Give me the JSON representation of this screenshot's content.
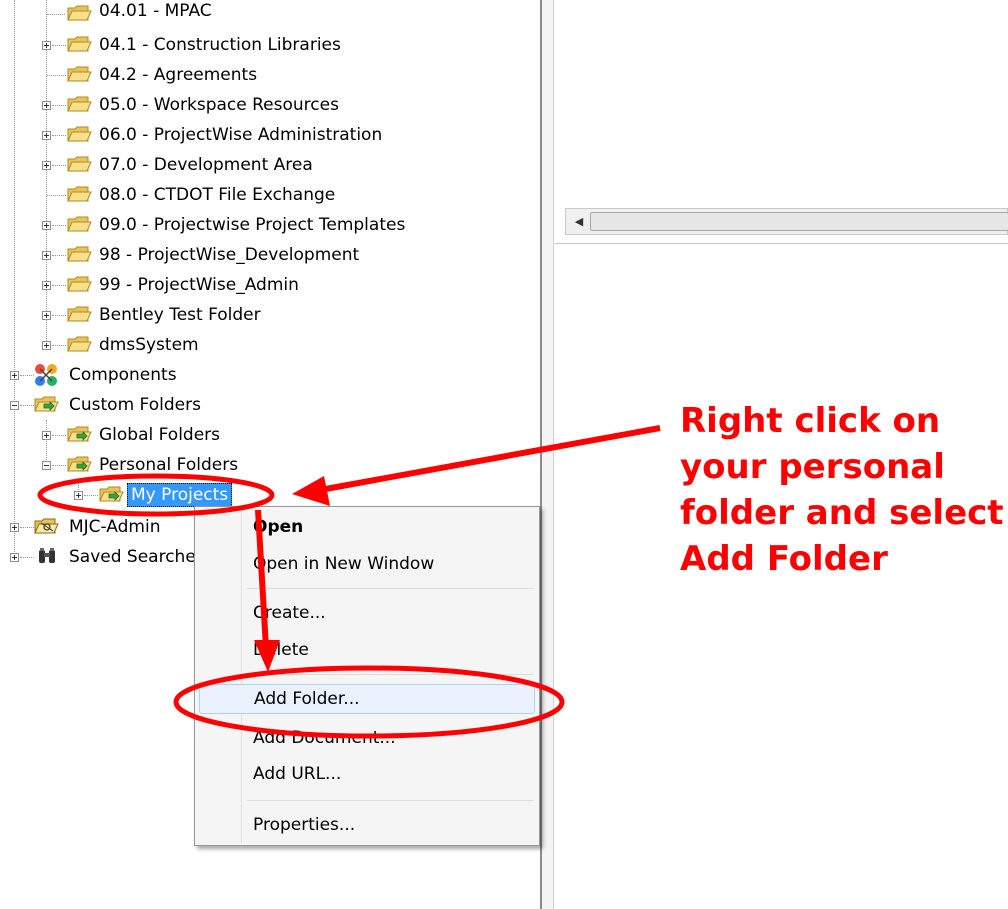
{
  "tree": {
    "items": [
      {
        "label": "04.01 - MPAC"
      },
      {
        "label": "04.1 - Construction Libraries"
      },
      {
        "label": "04.2 - Agreements"
      },
      {
        "label": "05.0 - Workspace Resources"
      },
      {
        "label": "06.0 - ProjectWise Administration"
      },
      {
        "label": "07.0 - Development Area"
      },
      {
        "label": "08.0 - CTDOT File Exchange"
      },
      {
        "label": "09.0 - Projectwise Project Templates"
      },
      {
        "label": "98 - ProjectWise_Development"
      },
      {
        "label": "99 - ProjectWise_Admin"
      },
      {
        "label": "Bentley Test Folder"
      },
      {
        "label": "dmsSystem"
      },
      {
        "label": "Components"
      },
      {
        "label": "Custom Folders"
      },
      {
        "label": "Global Folders"
      },
      {
        "label": "Personal Folders"
      },
      {
        "label": "My Projects"
      },
      {
        "label": "MJC-Admin"
      },
      {
        "label": "Saved Searches"
      }
    ]
  },
  "context_menu": {
    "items": [
      {
        "label": "Open"
      },
      {
        "label": "Open in New Window"
      },
      {
        "label": "Create..."
      },
      {
        "label": "Delete"
      },
      {
        "label": "Add Folder..."
      },
      {
        "label": "Add Document..."
      },
      {
        "label": "Add URL..."
      },
      {
        "label": "Properties..."
      }
    ]
  },
  "annotation": {
    "lines": [
      "Right click on",
      "your personal",
      "folder and select",
      "Add Folder"
    ],
    "color": "#ff0000"
  },
  "colors": {
    "selection": "#3399ff",
    "menu_hover": "#eaf3fd",
    "folder": "#f3d96b"
  }
}
